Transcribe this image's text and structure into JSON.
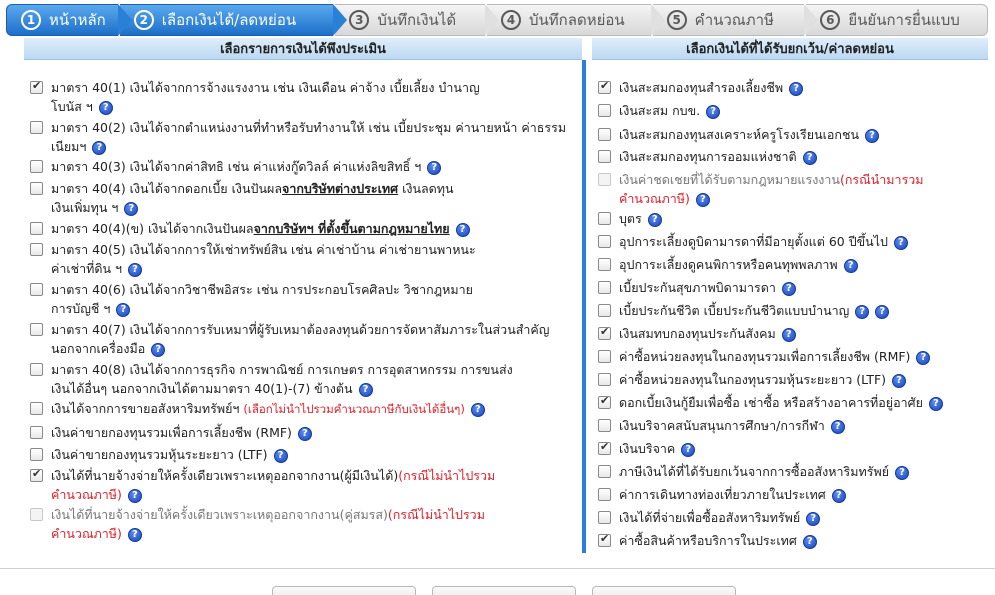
{
  "steps": [
    {
      "num": "1",
      "label": "หน้าหลัก"
    },
    {
      "num": "2",
      "label": "เลือกเงินได้/ลดหย่อน"
    },
    {
      "num": "3",
      "label": "บันทึกเงินได้"
    },
    {
      "num": "4",
      "label": "บันทึกลดหย่อน"
    },
    {
      "num": "5",
      "label": "คำนวณภาษี"
    },
    {
      "num": "6",
      "label": "ยืนยันการยื่นแบบ"
    }
  ],
  "left": {
    "title": "เลือกรายการเงินได้พึงประเมิน",
    "items": [
      {
        "checked": true,
        "line1": "มาตรา 40(1) เงินได้จากการจ้างแรงงาน เช่น เงินเดือน ค่าจ้าง เบี้ยเลี้ยง บำนาญ",
        "line2": "โบนัส ฯ"
      },
      {
        "checked": false,
        "line1": "มาตรา 40(2) เงินได้จากตำแหน่งงานที่ทำหรือรับทำงานให้ เช่น เบี้ยประชุม ค่านายหน้า ค่าธรรม",
        "line2": "เนียมฯ"
      },
      {
        "checked": false,
        "line1": "มาตรา 40(3) เงินได้จากค่าสิทธิ เช่น ค่าแห่งกู๊ดวิลล์ ค่าแห่งลิขสิทธิ์ ฯ"
      },
      {
        "checked": false,
        "line1a": "มาตรา 40(4) เงินได้จากดอกเบี้ย เงินปันผล",
        "line1b": "จากบริษัทต่างประเทศ",
        "line1c": " เงินลดทุน",
        "line2": "เงินเพิ่มทุน ฯ"
      },
      {
        "checked": false,
        "line1a": "มาตรา 40(4)(ข) เงินได้จากเงินปันผล",
        "line1b": "จากบริษัทฯ ที่ตั้งขึ้นตามกฎหมายไทย"
      },
      {
        "checked": false,
        "line1": "มาตรา 40(5) เงินได้จากการให้เช่าทรัพย์สิน เช่น ค่าเช่าบ้าน ค่าเช่ายานพาหนะ",
        "line2": "ค่าเช่าที่ดิน ฯ"
      },
      {
        "checked": false,
        "line1": "มาตรา 40(6) เงินได้จากวิชาชีพอิสระ เช่น การประกอบโรคศิลปะ วิชากฎหมาย",
        "line2": "การบัญชี ฯ"
      },
      {
        "checked": false,
        "line1": "มาตรา 40(7) เงินได้จากการรับเหมาที่ผู้รับเหมาต้องลงทุนด้วยการจัดหาสัมภาระในส่วนสำคัญ",
        "line2": "นอกจากเครื่องมือ"
      },
      {
        "checked": false,
        "line1": "มาตรา 40(8) เงินได้จากการธุรกิจ การพาณิชย์ การเกษตร การอุตสาหกรรม การขนส่ง",
        "line2": "เงินได้อื่นๆ นอกจากเงินได้ตามมาตรา 40(1)-(7) ข้างต้น"
      },
      {
        "checked": false,
        "line1": "เงินได้จากการขายอสังหาริมทรัพย์ฯ",
        "note": "(เลือกไม่นำไปรวมคำนวณภาษีกับเงินได้อื่นๆ)"
      },
      {
        "checked": false,
        "line1": "เงินค่าขายกองทุนรวมเพื่อการเลี้ยงชีพ (RMF)"
      },
      {
        "checked": false,
        "line1": "เงินค่าขายกองทุนรวมหุ้นระยะยาว (LTF)"
      },
      {
        "checked": true,
        "line1": "เงินได้ที่นายจ้างจ่ายให้ครั้งเดียวเพราะเหตุออกจากงาน(ผู้มีเงินได้)",
        "note": "(กรณีไม่นำไปรวม",
        "note2": "คำนวณภาษี)"
      },
      {
        "checked": false,
        "disabled": true,
        "line1": "เงินได้ที่นายจ้างจ่ายให้ครั้งเดียวเพราะเหตุออกจากงาน(คู่สมรส)",
        "note": "(กรณีไม่นำไปรวม",
        "note2": "คำนวณภาษี)"
      }
    ]
  },
  "right": {
    "title": "เลือกเงินได้ที่ได้รับยกเว้น/ค่าลดหย่อน",
    "items": [
      {
        "checked": true,
        "label": "เงินสะสมกองทุนสำรองเลี้ยงชีพ"
      },
      {
        "checked": false,
        "label": "เงินสะสม กบข."
      },
      {
        "checked": false,
        "label": "เงินสะสมกองทุนสงเคราะห์ครูโรงเรียนเอกชน"
      },
      {
        "checked": false,
        "label": "เงินสะสมกองทุนการออมแห่งชาติ"
      },
      {
        "checked": false,
        "disabled": true,
        "label": "เงินค่าชดเชยที่ได้รับตามกฎหมายแรงงาน",
        "note": "(กรณีนำมารวม",
        "note2": "คำนวณภาษี)"
      },
      {
        "checked": false,
        "label": "บุตร"
      },
      {
        "checked": false,
        "label": "อุปการะเลี้ยงดูบิดามารดาที่มีอายุตั้งแต่ 60 ปีขึ้นไป"
      },
      {
        "checked": false,
        "label": "อุปการะเลี้ยงดูคนพิการหรือคนทุพพลภาพ"
      },
      {
        "checked": false,
        "label": "เบี้ยประกันสุขภาพบิดามารดา"
      },
      {
        "checked": false,
        "label": "เบี้ยประกันชีวิต เบี้ยประกันชีวิตแบบบำนาญ",
        "double": true
      },
      {
        "checked": true,
        "label": "เงินสมทบกองทุนประกันสังคม"
      },
      {
        "checked": false,
        "label": "ค่าซื้อหน่วยลงทุนในกองทุนรวมเพื่อการเลี้ยงชีพ (RMF)"
      },
      {
        "checked": false,
        "label": "ค่าซื้อหน่วยลงทุนในกองทุนรวมหุ้นระยะยาว (LTF)"
      },
      {
        "checked": true,
        "label": "ดอกเบี้ยเงินกู้ยืมเพื่อซื้อ เช่าซื้อ หรือสร้างอาคารที่อยู่อาศัย"
      },
      {
        "checked": false,
        "label": "เงินบริจาคสนับสนุนการศึกษา/การกีฬา"
      },
      {
        "checked": true,
        "label": "เงินบริจาค"
      },
      {
        "checked": false,
        "label": "ภาษีเงินได้ที่ได้รับยกเว้นจากการซื้ออสังหาริมทรัพย์"
      },
      {
        "checked": false,
        "label": "ค่าการเดินทางท่องเที่ยวภายในประเทศ"
      },
      {
        "checked": false,
        "label": "เงินได้ที่จ่ายเพื่อซื้ออสังหาริมทรัพย์"
      },
      {
        "checked": true,
        "label": "ค่าซื้อสินค้าหรือบริการในประเทศ"
      }
    ]
  },
  "help_glyph": "?",
  "check_glyph": "✔",
  "colors": {
    "accent": "#2a7fd6",
    "note": "#e0202a",
    "help": "#1843b8"
  }
}
